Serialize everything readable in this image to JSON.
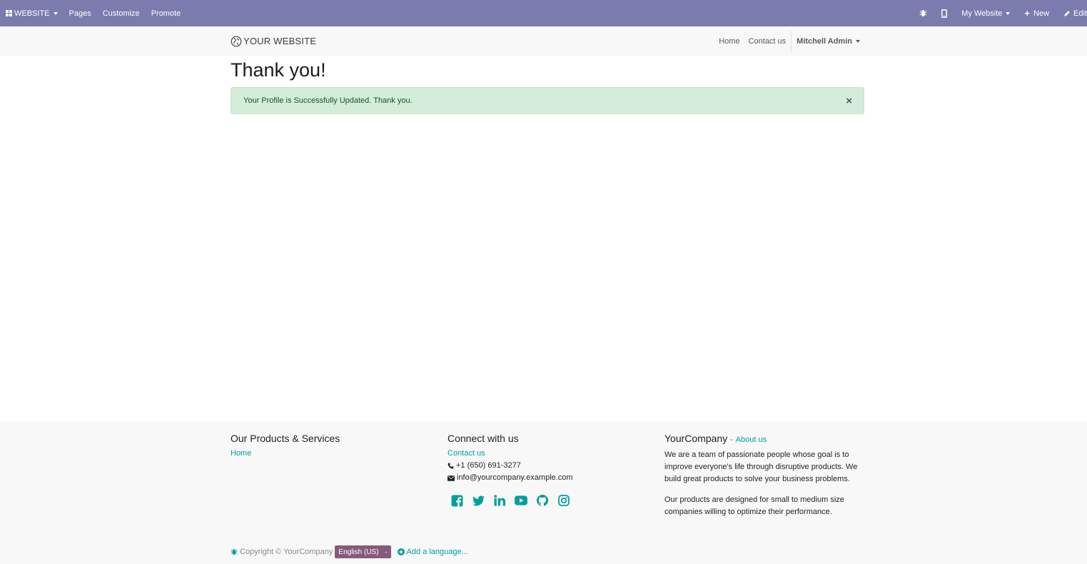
{
  "admin_bar": {
    "website_menu": "WEBSITE",
    "pages": "Pages",
    "customize": "Customize",
    "promote": "Promote",
    "my_website": "My Website",
    "new": "New",
    "edit": "Edit",
    "bar_color": "#7c7bad"
  },
  "header": {
    "logo_text": "YOUR WEBSITE",
    "nav": [
      "Home",
      "Contact us"
    ],
    "user": "Mitchell Admin"
  },
  "main": {
    "title": "Thank you!",
    "alert_message": "Your Profile is Successfully Updated. Thank you.",
    "alert_close": "×"
  },
  "footer": {
    "col1": {
      "heading": "Our Products & Services",
      "links": [
        "Home"
      ]
    },
    "col2": {
      "heading": "Connect with us",
      "contact_link": "Contact us",
      "phone": "+1 (650) 691-3277",
      "email": "info@yourcompany.example.com",
      "socials": [
        "facebook-icon",
        "twitter-icon",
        "linkedin-icon",
        "youtube-icon",
        "github-icon",
        "instagram-icon"
      ]
    },
    "col3": {
      "heading": "YourCompany",
      "separator": "-",
      "about_link": "About us",
      "para1": "We are a team of passionate people whose goal is to improve everyone's life through disruptive products. We build great products to solve your business problems.",
      "para2": "Our products are designed for small to medium size companies willing to optimize their performance."
    },
    "copyright": "Copyright © YourCompany",
    "language": "English (US)",
    "language_dd": "-",
    "add_language": "Add a language..."
  },
  "colors": {
    "accent": "#00a09d",
    "language_button": "#875a7b",
    "alert_bg": "#d4ecda",
    "alert_text": "#155724"
  }
}
